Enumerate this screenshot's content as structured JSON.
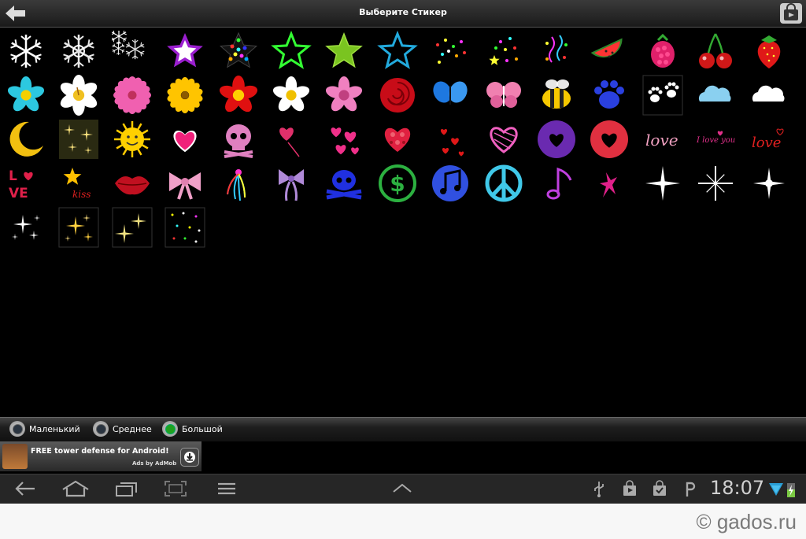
{
  "title": "Выберите Стикер",
  "stickers": [
    "snowflake-white-icon",
    "snowflake-lace-icon",
    "snowflakes-small-icon",
    "star-glow-purple-icon",
    "star-confetti-icon",
    "star-outline-green-icon",
    "star-scribble-green-icon",
    "star-scribble-cyan-icon",
    "confetti-stars-icon",
    "confetti-stars-2-icon",
    "confetti-streamers-icon",
    "watermelon-icon",
    "raspberry-icon",
    "cherries-icon",
    "strawberry-icon",
    "flower-cyan-icon",
    "lily-white-icon",
    "daisy-pink-icon",
    "sunflower-icon",
    "hibiscus-red-icon",
    "flower-white-icon",
    "flower-pink-icon",
    "rose-red-icon",
    "butterfly-blue-icon",
    "butterfly-pink-icon",
    "bee-icon",
    "paw-blue-icon",
    "paws-white-icon",
    "cloud-blue-icon",
    "cloud-white-icon",
    "moon-icon",
    "stars-sparkle-icon",
    "sun-face-icon",
    "heart-pink-icon",
    "skull-pink-icon",
    "heart-balloon-icon",
    "hearts-pink-icon",
    "heart-mosaic-icon",
    "hearts-small-red-icon",
    "heart-scribble-pink-icon",
    "heart-circle-purple-icon",
    "heart-circle-red-icon",
    "love-script-pink-icon",
    "i-love-you-icon",
    "love-script-red-icon",
    "love-block-icon",
    "star-kiss-icon",
    "lips-icon",
    "bow-pink-icon",
    "ribbon-streamers-icon",
    "bow-purple-icon",
    "skull-blue-icon",
    "dollar-circle-icon",
    "music-note-circle-icon",
    "peace-sign-icon",
    "music-note-purple-icon",
    "splash-magenta-icon",
    "sparkle-white-icon",
    "sparkle-burst-icon",
    "sparkle-star-icon",
    "sparkles-white-icon",
    "sparkles-gold-icon",
    "sparkles-yellow-icon",
    "sparkles-dots-icon"
  ],
  "sizes": [
    {
      "label": "Маленький",
      "selected": false
    },
    {
      "label": "Среднее",
      "selected": false
    },
    {
      "label": "Большой",
      "selected": true
    }
  ],
  "ad": {
    "text": "FREE tower defense for Android!",
    "sub": "Ads by AdMob"
  },
  "status": {
    "time": "18:07"
  },
  "footer": {
    "copyright": "© gados.ru"
  },
  "colors": {
    "accent_green": "#1fa11f",
    "background": "#000000"
  }
}
